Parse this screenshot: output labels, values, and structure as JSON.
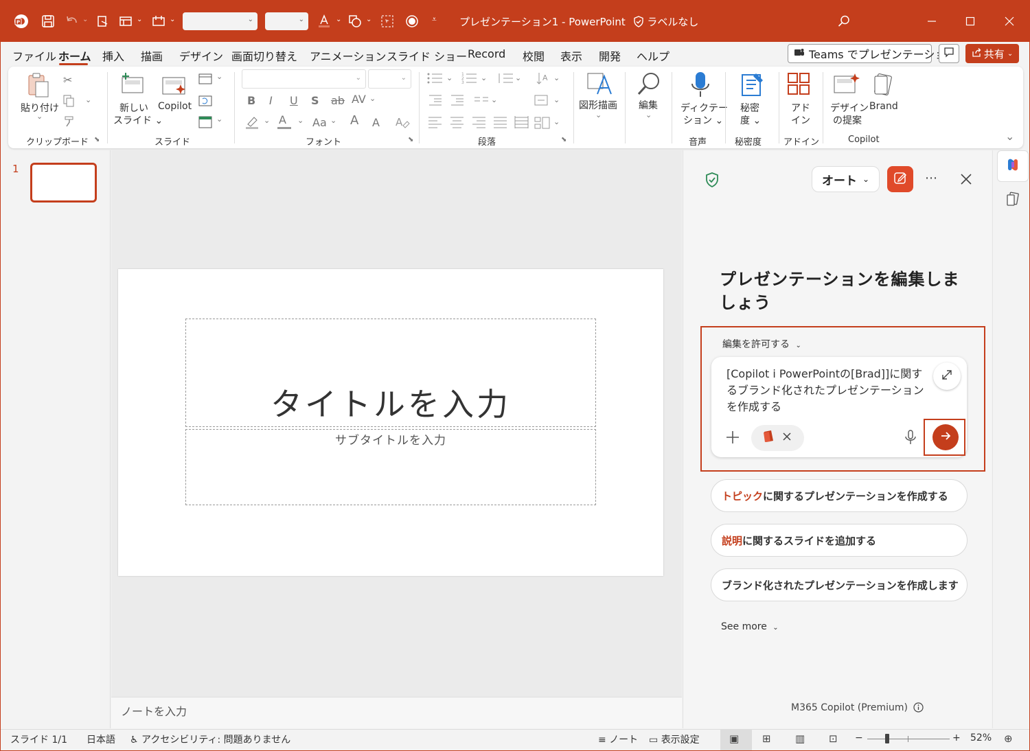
{
  "titlebar": {
    "title": "プレゼンテーション1 - PowerPoint",
    "label": "ラベルなし",
    "icons": [
      "powerpoint-logo",
      "save-icon",
      "undo-icon",
      "touch-mode-icon",
      "layout-icon",
      "arrange-icon",
      "font-color-icon",
      "shapes-icon",
      "select-icon",
      "record-icon",
      "customize-icon",
      "search-icon",
      "minimize-icon",
      "maximize-icon",
      "close-icon"
    ]
  },
  "menu": {
    "items": [
      "ファイル",
      "ホーム",
      "挿入",
      "描画",
      "デザイン",
      "画面切り替え",
      "アニメーション",
      "スライド ショー",
      "Record",
      "校閲",
      "表示",
      "開発",
      "ヘルプ"
    ],
    "teams": "Teams でプレゼンテーション",
    "share": "共有"
  },
  "ribbon": {
    "paste": "貼り付け",
    "new_slide_1": "新しい",
    "new_slide_2": "スライド ⌄",
    "copilot": "Copilot",
    "draw_shapes": "図形描画",
    "edit": "編集",
    "dictate_1": "ディクテー",
    "dictate_2": "ション ⌄",
    "sensitivity_1": "秘密",
    "sensitivity_2": "度 ⌄",
    "addins_1": "アド",
    "addins_2": "イン",
    "designer_1": "デザイン",
    "designer_2": "の提案",
    "brand": "Brand",
    "groups": {
      "clipboard": "クリップボード",
      "slides": "スライド",
      "font": "フォント",
      "paragraph": "段落",
      "voice": "音声",
      "sensitivity": "秘密度",
      "addins": "アドイン",
      "copilot": "Copilot"
    },
    "font_buttons": [
      "B",
      "I",
      "U",
      "S",
      "ab",
      "AV",
      "A",
      "Aa",
      "A",
      "A"
    ]
  },
  "slides": {
    "number": "1",
    "title_placeholder": "タイトルを入力",
    "subtitle_placeholder": "サブタイトルを入力",
    "notes_placeholder": "ノートを入力"
  },
  "copilot": {
    "mode": "オート",
    "heading": "プレゼンテーションを編集しましょう",
    "permission": "編集を許可する",
    "prompt": "[Copilot i PowerPointの[Brad]]に関するブランド化されたプレゼンテーションを作成する",
    "suggestions": [
      {
        "highlight": "トピック",
        "text": "に関するプレゼンテーションを作成する"
      },
      {
        "highlight": "説明",
        "text": "に関するスライドを追加する"
      },
      {
        "highlight": "",
        "text": "ブランド化されたプレゼンテーションを作成します"
      }
    ],
    "see_more": "See more",
    "footer": "M365 Copilot (Premium)"
  },
  "status": {
    "slide": "スライド 1/1",
    "language": "日本語",
    "accessibility": "アクセシビリティ: 問題ありません",
    "notes": "ノート",
    "display": "表示設定",
    "zoom": "52%",
    "zoom_level_pct": 52
  },
  "colors": {
    "brand": "#c43e1c",
    "accent_orange": "#e04a2a",
    "shield_green": "#2e8b57"
  }
}
